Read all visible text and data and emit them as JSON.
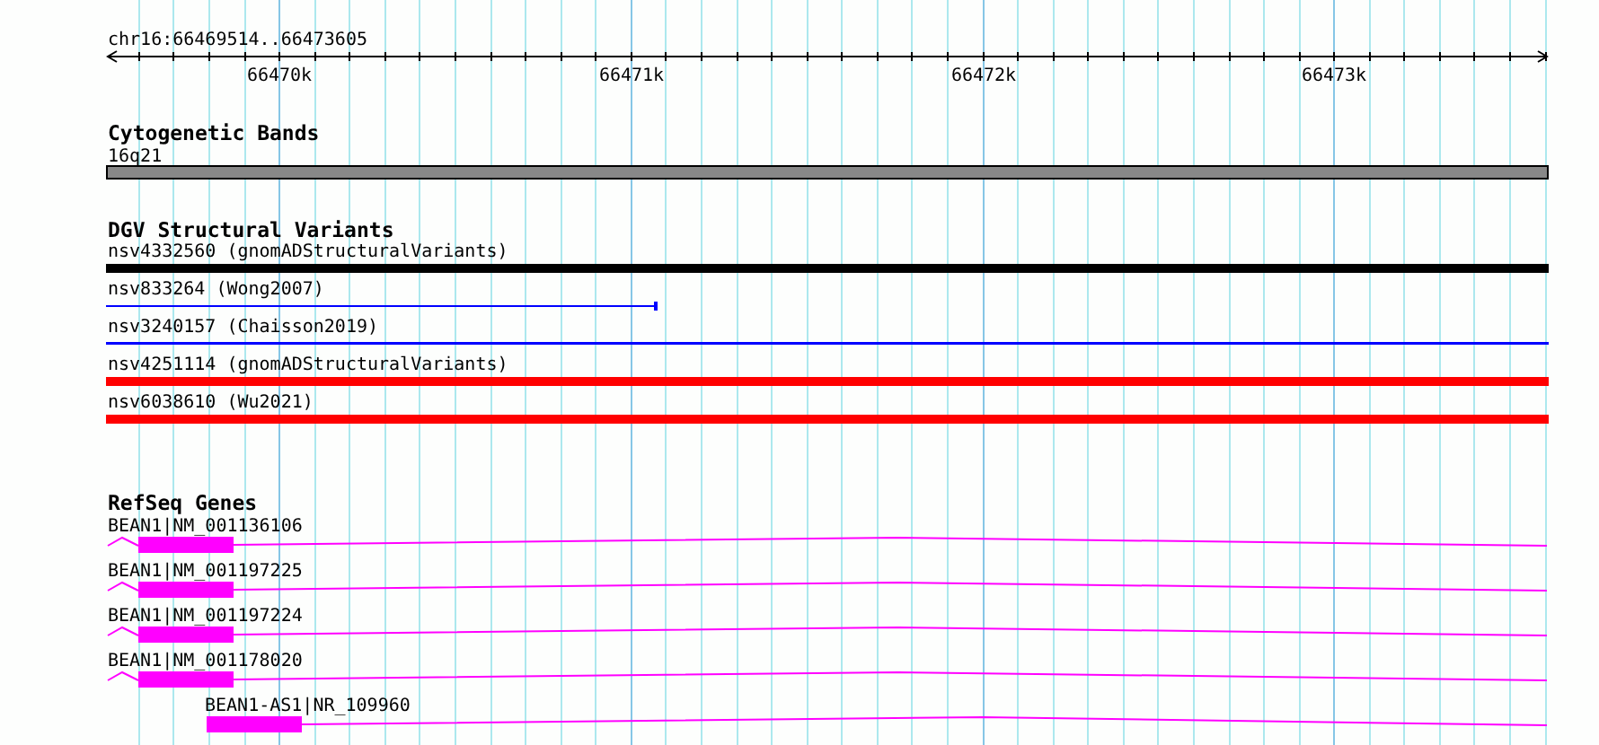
{
  "location": "chr16:66469514..66473605",
  "ruler": {
    "labels": [
      "66470k",
      "66471k",
      "66472k",
      "66473k"
    ]
  },
  "tracks": [
    {
      "title": "Cytogenetic Bands",
      "kind": "bands",
      "features": [
        {
          "label": "16q21",
          "kind": "band"
        }
      ]
    },
    {
      "title": "DGV Structural Variants",
      "kind": "variants",
      "features": [
        {
          "label": "nsv4332560 (gnomADStructuralVariants)",
          "kind": "thick",
          "color": "#000000"
        },
        {
          "label": "nsv833264 (Wong2007)",
          "kind": "partial-line",
          "color": "#0000ff"
        },
        {
          "label": "nsv3240157 (Chaisson2019)",
          "kind": "line",
          "color": "#0000ff"
        },
        {
          "label": "nsv4251114 (gnomADStructuralVariants)",
          "kind": "thick",
          "color": "#ff0000"
        },
        {
          "label": "nsv6038610 (Wu2021)",
          "kind": "thick",
          "color": "#ff0000"
        }
      ]
    },
    {
      "title": "RefSeq Genes",
      "kind": "genes",
      "features": [
        {
          "label": "BEAN1|NM_001136106",
          "kind": "sense"
        },
        {
          "label": "BEAN1|NM_001197225",
          "kind": "sense"
        },
        {
          "label": "BEAN1|NM_001197224",
          "kind": "sense"
        },
        {
          "label": "BEAN1|NM_001178020",
          "kind": "sense"
        },
        {
          "label": "BEAN1-AS1|NR_109960",
          "kind": "antisense"
        }
      ]
    }
  ]
}
